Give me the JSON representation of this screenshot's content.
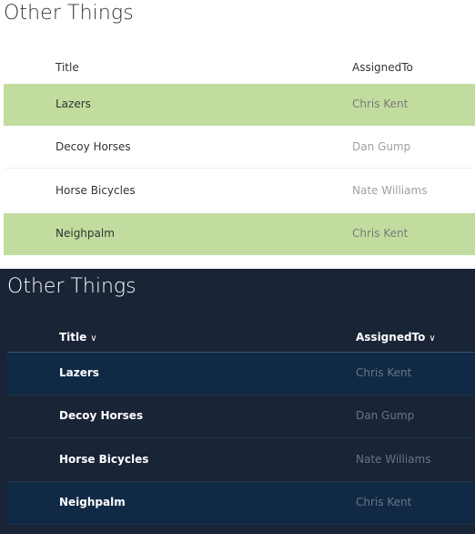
{
  "light": {
    "title": "Other Things",
    "columns": {
      "title": "Title",
      "assigned": "AssignedTo"
    },
    "rows": [
      {
        "title": "Lazers",
        "assigned": "Chris Kent",
        "highlighted": true
      },
      {
        "title": "Decoy Horses",
        "assigned": "Dan Gump",
        "highlighted": false
      },
      {
        "title": "Horse Bicycles",
        "assigned": "Nate Williams",
        "highlighted": false
      },
      {
        "title": "Neighpalm",
        "assigned": "Chris Kent",
        "highlighted": true
      }
    ],
    "colors": {
      "highlight": "#c1dc9e",
      "background": "#ffffff"
    }
  },
  "dark": {
    "title": "Other Things",
    "columns": {
      "title": "Title",
      "assigned": "AssignedTo"
    },
    "rows": [
      {
        "title": "Lazers",
        "assigned": "Chris Kent",
        "highlighted": true
      },
      {
        "title": "Decoy Horses",
        "assigned": "Dan Gump",
        "highlighted": false
      },
      {
        "title": "Horse Bicycles",
        "assigned": "Nate Williams",
        "highlighted": false
      },
      {
        "title": "Neighpalm",
        "assigned": "Chris Kent",
        "highlighted": true
      }
    ],
    "icons": {
      "sort": "chevron-down-icon"
    },
    "colors": {
      "highlight": "#102a45",
      "background": "#192436"
    }
  }
}
